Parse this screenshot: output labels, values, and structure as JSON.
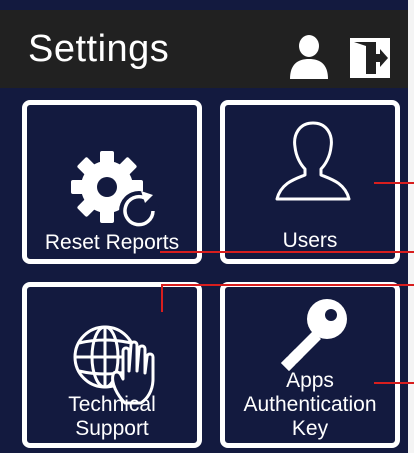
{
  "header": {
    "title": "Settings",
    "icons": [
      "user-icon",
      "logout-icon"
    ]
  },
  "tiles": [
    {
      "label": "Reset Reports",
      "icon": "gear-reset-icon"
    },
    {
      "label": "Users",
      "icon": "user-outline-icon"
    },
    {
      "label": "Technical Support",
      "lines": [
        "Technical",
        "Support"
      ],
      "icon": "globe-hand-icon"
    },
    {
      "label": "Apps Authentication Key",
      "lines": [
        "Apps",
        "Authentication",
        "Key"
      ],
      "icon": "key-icon"
    }
  ],
  "colors": {
    "background": "#131a3f",
    "header": "#212121",
    "tile_border": "#ffffff",
    "annotation_line": "#d81e1e"
  }
}
